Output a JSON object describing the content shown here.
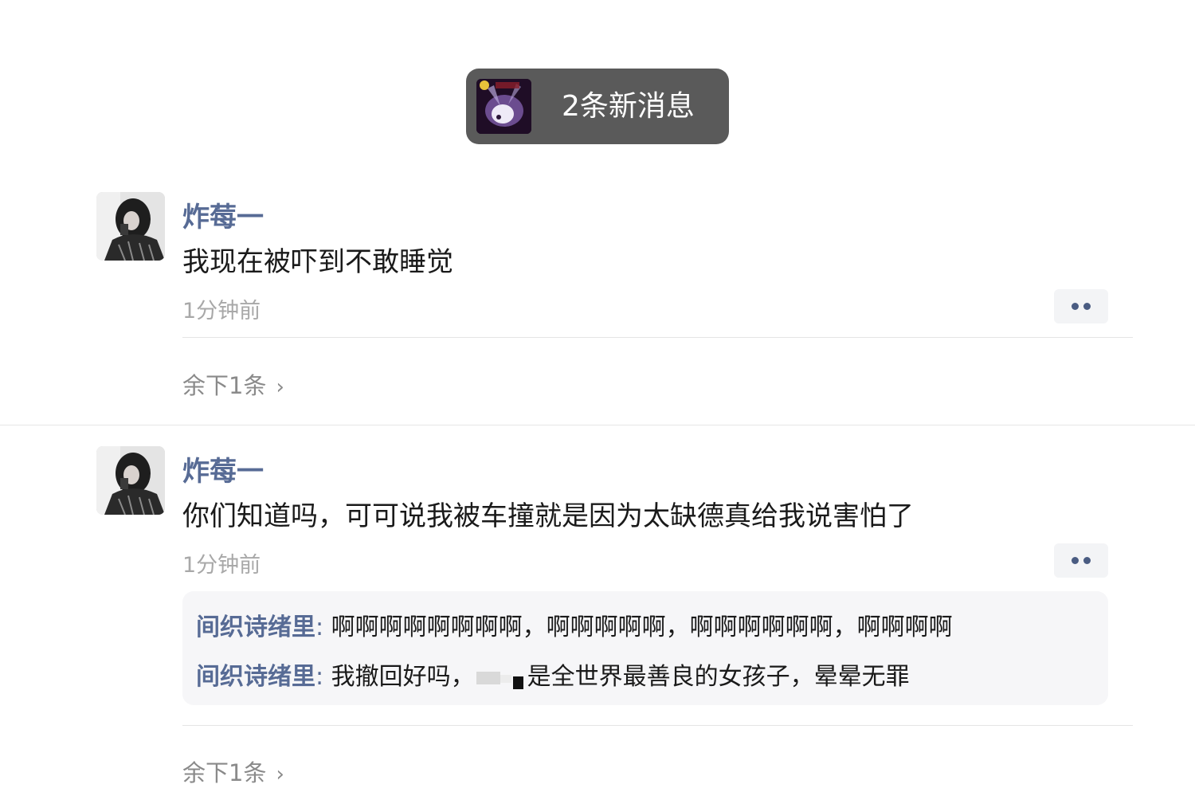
{
  "notification": {
    "text": "2条新消息"
  },
  "posts": [
    {
      "username": "炸莓一",
      "content": "我现在被吓到不敢睡觉",
      "time": "1分钟前",
      "remaining": "余下1条"
    },
    {
      "username": "炸莓一",
      "content": "你们知道吗，可可说我被车撞就是因为太缺德真给我说害怕了",
      "time": "1分钟前",
      "replies": [
        {
          "name": "间织诗绪里",
          "separator": ":",
          "text": "啊啊啊啊啊啊啊啊，啊啊啊啊啊，啊啊啊啊啊啊，啊啊啊啊"
        },
        {
          "name": "间织诗绪里",
          "separator": ":",
          "text_before": "我撤回好吗，",
          "text_after": "是全世界最善良的女孩子，晕晕无罪"
        }
      ],
      "remaining": "余下1条"
    }
  ],
  "icons": {
    "more": "more-dots-icon",
    "chevron": "chevron-right-icon"
  },
  "colors": {
    "username": "#576b95",
    "pill_bg": "#5a5a5a",
    "time": "#a8a8a8"
  }
}
